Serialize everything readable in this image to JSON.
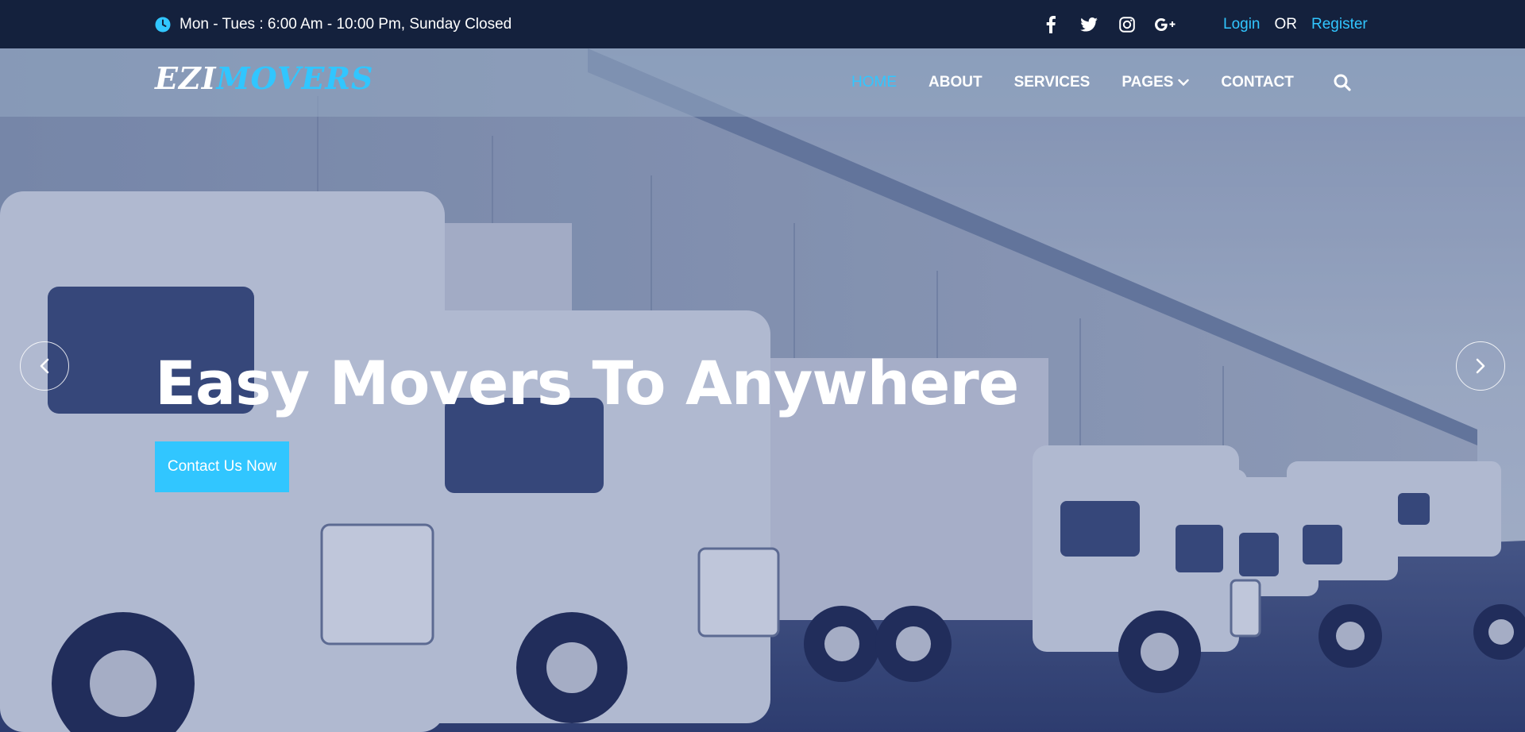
{
  "topbar": {
    "hours": "Mon - Tues : 6:00 Am - 10:00 Pm, Sunday Closed",
    "socials": [
      "facebook-icon",
      "twitter-icon",
      "instagram-icon",
      "google-plus-icon"
    ],
    "login": "Login",
    "or": "OR",
    "register": "Register"
  },
  "nav": {
    "logo_part1": "EZI",
    "logo_part2": "MOVERS",
    "items": [
      {
        "label": "HOME"
      },
      {
        "label": "ABOUT"
      },
      {
        "label": "SERVICES"
      },
      {
        "label": "PAGES"
      },
      {
        "label": "CONTACT"
      }
    ]
  },
  "hero": {
    "headline": "Easy Movers To Anywhere",
    "cta": "Contact Us Now"
  },
  "colors": {
    "accent": "#31c6ff",
    "topbar": "#14213d"
  }
}
